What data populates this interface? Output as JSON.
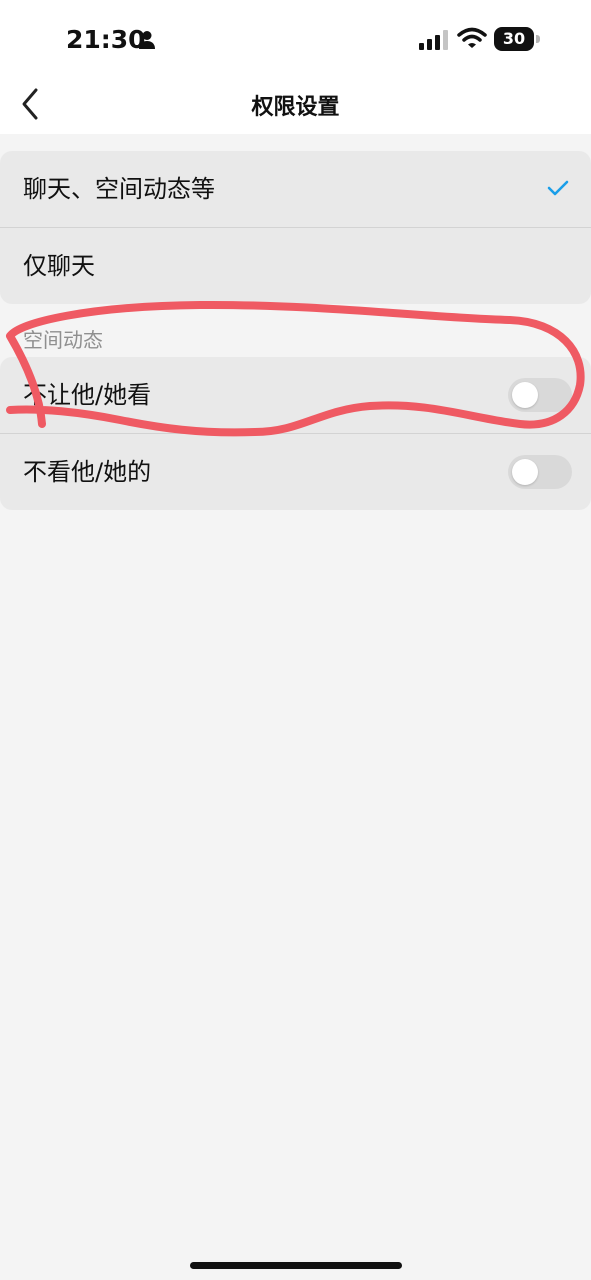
{
  "status_bar": {
    "time": "21:30",
    "battery_level": "30"
  },
  "nav": {
    "title": "权限设置"
  },
  "permission_options": [
    {
      "label": "聊天、空间动态等",
      "selected": true
    },
    {
      "label": "仅聊天",
      "selected": false
    }
  ],
  "moments_section": {
    "header": "空间动态",
    "rows": [
      {
        "label": "不让他/她看",
        "toggle_on": false
      },
      {
        "label": "不看他/她的",
        "toggle_on": false
      }
    ]
  },
  "colors": {
    "accent_check": "#1a9ee9",
    "annotation_stroke": "#ef5a63",
    "toggle_off": "#d9d9d9"
  }
}
